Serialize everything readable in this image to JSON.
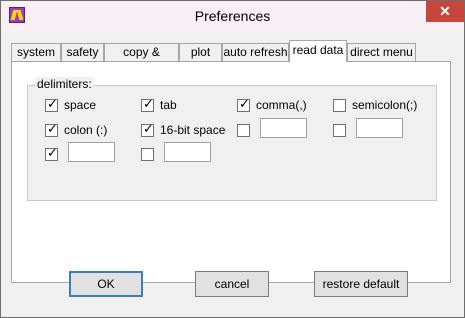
{
  "window": {
    "title": "Preferences",
    "close_label": "✕"
  },
  "tabs": [
    {
      "label": "system"
    },
    {
      "label": "safety"
    },
    {
      "label": "copy & export"
    },
    {
      "label": "plot"
    },
    {
      "label": "auto refresh"
    },
    {
      "label": "read data",
      "active": true
    },
    {
      "label": "direct menu"
    }
  ],
  "delimiters": {
    "group_label": "delimiters:",
    "options": [
      {
        "label": "space",
        "checked": true
      },
      {
        "label": "tab",
        "checked": true
      },
      {
        "label": "comma(,)",
        "checked": true
      },
      {
        "label": "semicolon(;)",
        "checked": false
      },
      {
        "label": "colon (:)",
        "checked": true
      },
      {
        "label": "16-bit space",
        "checked": true
      }
    ],
    "custom": [
      {
        "checked": false,
        "value": ""
      },
      {
        "checked": false,
        "value": ""
      },
      {
        "checked": true,
        "value": ""
      },
      {
        "checked": false,
        "value": ""
      }
    ]
  },
  "buttons": {
    "ok": "OK",
    "cancel": "cancel",
    "restore": "restore default"
  }
}
